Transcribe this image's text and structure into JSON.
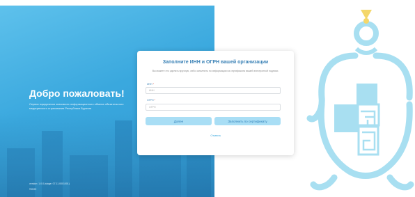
{
  "brand": {
    "accent": "#3aa8de",
    "title_color": "#3b82b6",
    "button_bg": "#a9def5"
  },
  "left": {
    "welcome": "Добро пожаловать!",
    "subtitle": "Сервис юридически значимого информационного обмена обязательного медицинского страхования Республики Бурятия",
    "version": "version: 1.0.0 (stage: 07.11.0001001)",
    "copyright": "©2022"
  },
  "form": {
    "title": "Заполните ИНН и ОГРН вашей организации",
    "description": "Вы можете это сделать вручную, либо заполнить по информации из сертификата вашей электронной подписи.",
    "inn": {
      "label": "ИНН",
      "required_mark": "*",
      "placeholder": "ИНН",
      "value": ""
    },
    "ogrn": {
      "label": "ОГРН",
      "required_mark": "*",
      "placeholder": "ОГРН",
      "value": ""
    },
    "next_label": "Далее",
    "cert_label": "Заполнить по сертификату",
    "cancel_label": "Отмена"
  },
  "icons": {
    "emblem": "tfoms-emblem-icon"
  }
}
